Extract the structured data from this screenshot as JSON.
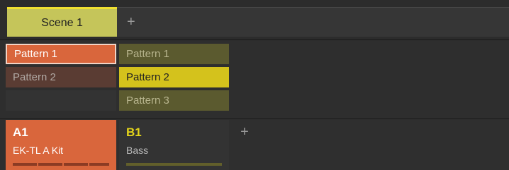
{
  "scenes": {
    "tabs": [
      {
        "label": "Scene 1",
        "selected": true
      }
    ],
    "add_label": "+"
  },
  "patterns": {
    "group_a": [
      {
        "label": "Pattern 1",
        "selected": true
      },
      {
        "label": "Pattern 2",
        "selected": false
      },
      {
        "label": "",
        "selected": false
      }
    ],
    "group_b": [
      {
        "label": "Pattern 1",
        "selected": false
      },
      {
        "label": "Pattern 2",
        "selected": true
      },
      {
        "label": "Pattern 3",
        "selected": false
      }
    ]
  },
  "groups": {
    "items": [
      {
        "id": "A1",
        "name": "EK-TL A Kit",
        "color": "#d9663c"
      },
      {
        "id": "B1",
        "name": "Bass",
        "color": "#e4d51a"
      }
    ],
    "add_label": "+"
  },
  "colors": {
    "scene_accent": "#f0e030",
    "group_a": "#d9663c",
    "group_b": "#d4c21c"
  }
}
